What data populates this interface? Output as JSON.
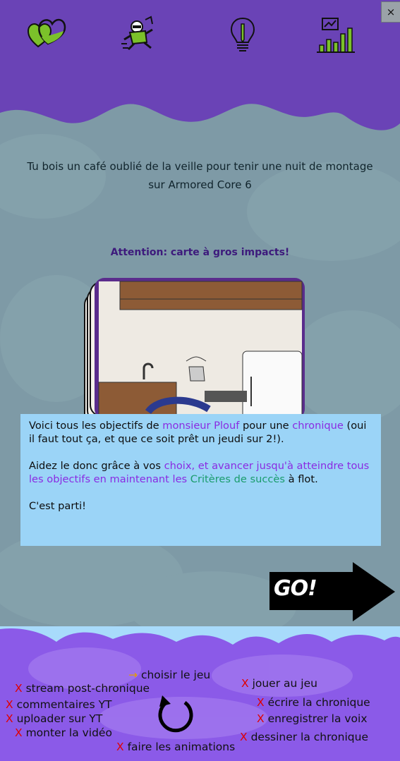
{
  "topbar": {
    "icons": [
      "hearts-icon",
      "running-character-icon",
      "lightbulb-icon",
      "chart-icon"
    ],
    "close_label": "×"
  },
  "question": "Tu bois un café oublié de la veille pour tenir une nuit de montage sur Armored Core 6",
  "warning": "Attention: carte à gros impacts!",
  "dialog": {
    "p1_a": "Voici tous les objectifs de ",
    "p1_b": "monsieur Plouf",
    "p1_c": " pour une ",
    "p1_d": "chronique",
    "p1_e": " (oui il faut tout ça, et que ce soit prêt un jeudi sur 2!).",
    "p2_a": "Aidez le donc grâce à vos ",
    "p2_b": "choix, et avancer jusqu'à atteindre tous les objectifs en maintenant les ",
    "p2_c": "Critères de succès",
    "p2_d": " à flot.",
    "p3": "C'est parti!"
  },
  "go_label": "GO!",
  "tasks": [
    {
      "mark": "→",
      "label": "choisir le jeu",
      "status": "current"
    },
    {
      "mark": "X",
      "label": "stream post-chronique",
      "status": "todo"
    },
    {
      "mark": "X",
      "label": "commentaires YT",
      "status": "todo"
    },
    {
      "mark": "X",
      "label": "uploader sur YT",
      "status": "todo"
    },
    {
      "mark": "X",
      "label": "monter la vidéo",
      "status": "todo"
    },
    {
      "mark": "X",
      "label": "faire les animations",
      "status": "todo"
    },
    {
      "mark": "X",
      "label": "jouer au jeu",
      "status": "todo"
    },
    {
      "mark": "X",
      "label": "écrire la chronique",
      "status": "todo"
    },
    {
      "mark": "X",
      "label": "enregistrer la voix",
      "status": "todo"
    },
    {
      "mark": "X",
      "label": "dessiner la chronique",
      "status": "todo"
    }
  ],
  "colors": {
    "top_purple": "#6a43b6",
    "bottom_purple": "#8b5ae8",
    "dialog_bg": "#9bd4f7",
    "highlight_purple": "#8a2be2",
    "highlight_green": "#1a9c6c",
    "icon_green": "#7bc12a"
  }
}
